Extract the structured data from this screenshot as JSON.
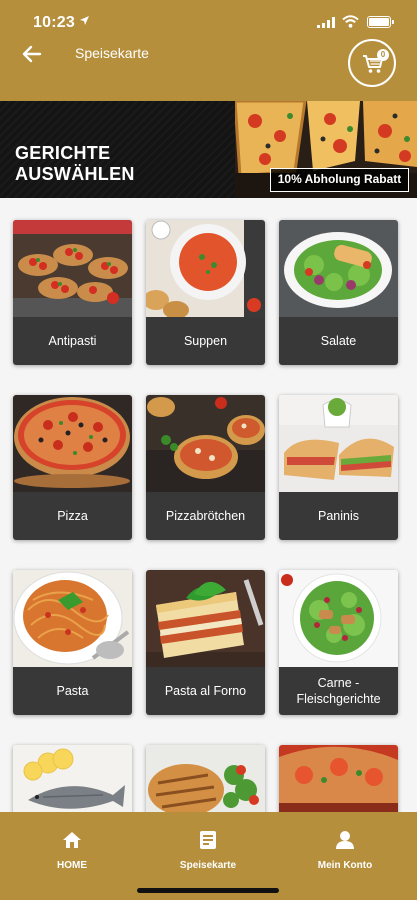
{
  "status": {
    "time": "10:23"
  },
  "header": {
    "title": "Speisekarte",
    "cart_count": "0"
  },
  "banner": {
    "heading_line1": "GERICHTE",
    "heading_line2": "AUSWÄHLEN",
    "promo": "10% Abholung Rabatt"
  },
  "categories": [
    {
      "label": "Antipasti",
      "icon": "bruschetta"
    },
    {
      "label": "Suppen",
      "icon": "tomato-soup"
    },
    {
      "label": "Salate",
      "icon": "salad"
    },
    {
      "label": "Pizza",
      "icon": "pizza"
    },
    {
      "label": "Pizzabrötchen",
      "icon": "pizza-rolls"
    },
    {
      "label": "Paninis",
      "icon": "panini"
    },
    {
      "label": "Pasta",
      "icon": "spaghetti"
    },
    {
      "label": "Pasta al Forno",
      "icon": "lasagna"
    },
    {
      "label": "Carne - Fleischgerichte",
      "icon": "meat-salad"
    },
    {
      "label": "",
      "icon": "fish"
    },
    {
      "label": "",
      "icon": "grilled-chicken"
    },
    {
      "label": "",
      "icon": "calzone"
    }
  ],
  "nav": {
    "home": "HOME",
    "menu": "Speisekarte",
    "account": "Mein Konto"
  },
  "colors": {
    "brand": "#b58f3c",
    "label_bg": "#383838"
  }
}
